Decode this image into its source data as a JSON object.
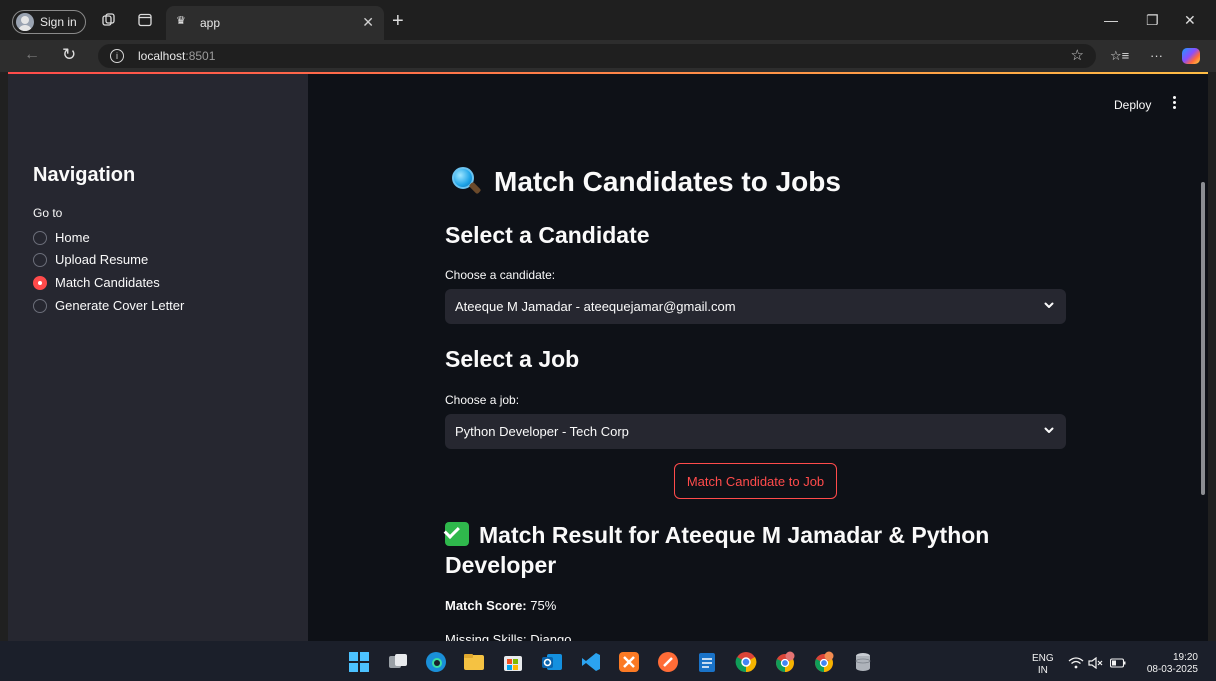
{
  "browser": {
    "signin_label": "Sign in",
    "tab_title": "app",
    "url_host": "localhost",
    "url_port": ":8501"
  },
  "sidebar": {
    "title": "Navigation",
    "group_label": "Go to",
    "items": [
      {
        "label": "Home",
        "selected": false
      },
      {
        "label": "Upload Resume",
        "selected": false
      },
      {
        "label": "Match Candidates",
        "selected": true
      },
      {
        "label": "Generate Cover Letter",
        "selected": false
      }
    ]
  },
  "toolbar": {
    "deploy_label": "Deploy"
  },
  "main": {
    "title": "Match Candidates to Jobs",
    "candidate_heading": "Select a Candidate",
    "candidate_label": "Choose a candidate:",
    "candidate_value": "Ateeque M Jamadar - ateequejamar@gmail.com",
    "job_heading": "Select a Job",
    "job_label": "Choose a job:",
    "job_value": "Python Developer - Tech Corp",
    "match_button": "Match Candidate to Job",
    "result_heading": "Match Result for Ateeque M Jamadar & Python Developer",
    "score_label": "Match Score:",
    "score_value": "75%",
    "missing_text": "Missing Skills: Django"
  },
  "taskbar": {
    "lang_top": "ENG",
    "lang_bottom": "IN",
    "time": "19:20",
    "date": "08-03-2025"
  },
  "colors": {
    "accent": "#ff4b4b",
    "sidebar_bg": "#262730",
    "main_bg": "#0e1117"
  }
}
